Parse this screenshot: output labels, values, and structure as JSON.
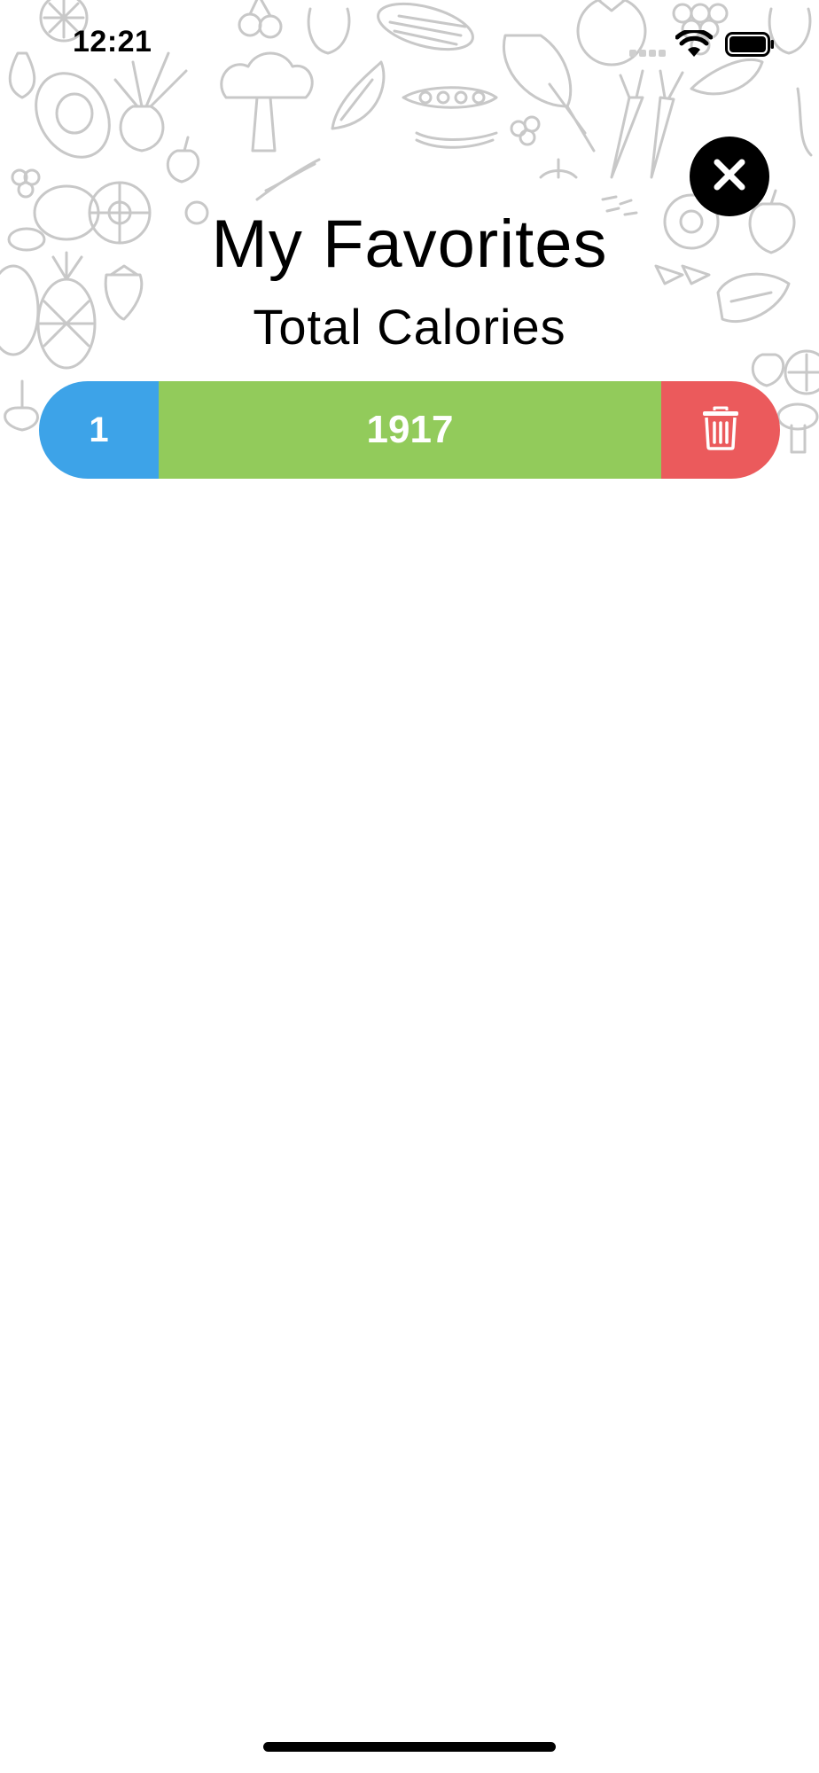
{
  "status_bar": {
    "time": "12:21",
    "icons": [
      "cellular-signal-icon",
      "wifi-icon",
      "battery-icon"
    ]
  },
  "header": {
    "close_icon": "close-icon",
    "title": "My Favorites",
    "subtitle": "Total Calories"
  },
  "favorites": [
    {
      "count": "1",
      "calories": "1917",
      "delete_icon": "trash-icon"
    }
  ],
  "colors": {
    "count_bg": "#3da3e8",
    "calories_bg": "#92cb5b",
    "delete_bg": "#eb5a5c",
    "doodle_stroke": "#c8c8c8"
  },
  "background": {
    "pattern": "fruit-and-vegetable-doodles"
  }
}
